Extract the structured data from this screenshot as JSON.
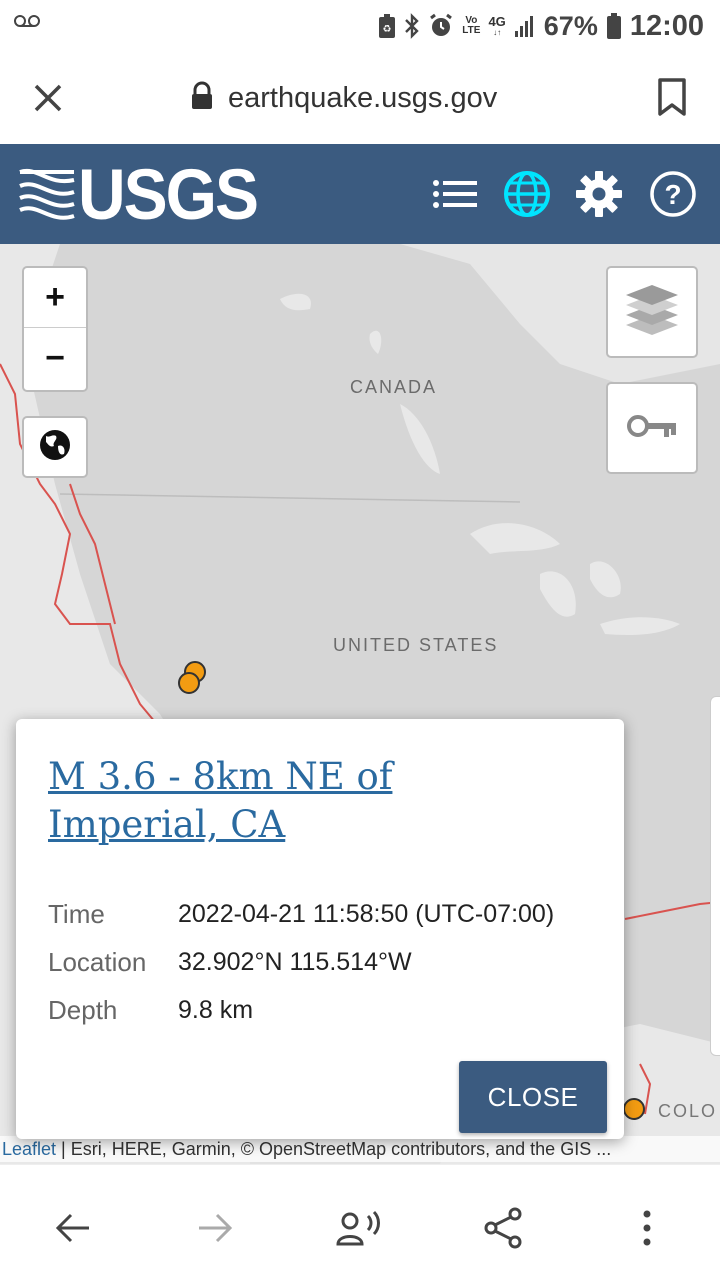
{
  "status_bar": {
    "volte_top": "Vo",
    "volte_bottom": "LTE",
    "network_top": "4G",
    "network_bottom": "↓↑",
    "battery_percent": "67%",
    "time": "12:00",
    "icons": [
      "voicemail-icon",
      "data-saver-icon",
      "bluetooth-icon",
      "alarm-icon",
      "signal-icon",
      "battery-icon"
    ]
  },
  "browser": {
    "url": "earthquake.usgs.gov",
    "icons": [
      "close-icon",
      "lock-icon",
      "bookmark-icon"
    ]
  },
  "header": {
    "logo_text": "USGS",
    "icons": [
      "list-icon",
      "globe-icon",
      "gear-icon",
      "help-icon"
    ],
    "active_icon_color": "#00e5ff",
    "bg_color": "#3b5b80"
  },
  "map": {
    "labels": {
      "canada": "CANADA",
      "united_states": "UNITED STATES",
      "colo": "COLO"
    },
    "zoom_in": "+",
    "zoom_out": "−",
    "marker_color": "#f39c12",
    "plate_boundary_color": "#d9534f"
  },
  "popup": {
    "title": "M 3.6 - 8km NE of Imperial, CA",
    "details": [
      {
        "label": "Time",
        "value": "2022-04-21 11:58:50 (UTC-07:00)"
      },
      {
        "label": "Location",
        "value": "32.902°N 115.514°W"
      },
      {
        "label": "Depth",
        "value": "9.8 km"
      }
    ],
    "close_label": "CLOSE"
  },
  "attribution": {
    "leaflet": "Leaflet",
    "text": " | Esri, HERE, Garmin, © OpenStreetMap contributors, and the GIS ..."
  },
  "bottom_nav": {
    "icons": [
      "back-arrow-icon",
      "forward-arrow-icon",
      "read-aloud-icon",
      "share-icon",
      "more-vert-icon"
    ]
  }
}
